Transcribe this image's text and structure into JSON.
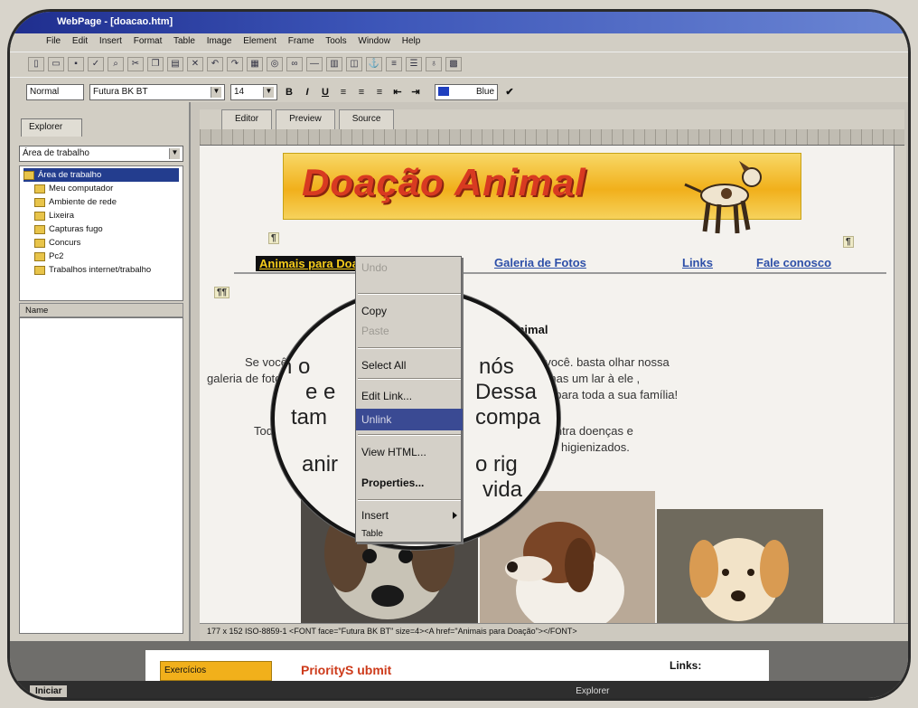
{
  "window": {
    "title": "WebPage - [doacao.htm]"
  },
  "menu": [
    "File",
    "Edit",
    "Insert",
    "Format",
    "Table",
    "Image",
    "Element",
    "Frame",
    "Tools",
    "Window",
    "Help"
  ],
  "format_toolbar": {
    "style": "Normal",
    "font": "Futura BK BT",
    "size": "14",
    "color_label": "Blue"
  },
  "left_panel": {
    "tab_label": "Explorer",
    "location": "Área de trabalho",
    "tree": [
      "Área de trabalho",
      "Meu computador",
      "Ambiente de rede",
      "Lixeira",
      "Capturas fugo",
      "Concurs",
      "Pc2",
      "Trabalhos internet/trabalho"
    ],
    "name_header": "Name"
  },
  "view_tabs": [
    "Editor",
    "Preview",
    "Source"
  ],
  "doc": {
    "banner_title": "Doação Animal",
    "nav": [
      "Animais para Doação",
      "Galeria de Fotos",
      "Links",
      "Fale conosco"
    ],
    "heading": "Doação Animal",
    "para1_line1": "Se você procura um amigo, nós temos o animal ideal pra você. basta olhar nossa",
    "para1_line2": "galeria de fotos. Adotando um animal, você estará dando não apenas um lar à ele ,",
    "para1_line3": "e estará criando um laço especial para toda a sua família!",
    "para2_line1": "Todos os animais são previamente vacinados, tratados contra doenças e",
    "para2_line2": "higienizados."
  },
  "magnified_words": [
    "n o",
    "nós",
    "e e",
    "Dessa",
    "tam",
    "compa",
    "anir",
    "o rig",
    "vida"
  ],
  "context_menu": {
    "items": [
      {
        "label": "Undo",
        "state": "disabled"
      },
      {
        "label": "Copy",
        "state": "normal"
      },
      {
        "label": "Paste",
        "state": "disabled"
      },
      {
        "label": "Select All",
        "state": "normal"
      },
      {
        "label": "Edit Link...",
        "state": "normal"
      },
      {
        "label": "Unlink",
        "state": "highlighted"
      },
      {
        "label": "View HTML...",
        "state": "normal"
      },
      {
        "label": "Properties...",
        "state": "normal"
      },
      {
        "label": "Insert",
        "state": "submenu"
      },
      {
        "label": "Table",
        "state": "normal"
      }
    ]
  },
  "status": {
    "text": "177 x 152   ISO-8859-1   <FONT face=\"Futura BK BT\" size=4><A href=\"Animais para Doação\"></FONT>"
  },
  "lower_panel": {
    "box_text": "Exercícios",
    "title": "PriorityS ubmit",
    "links_label": "Links:"
  },
  "taskbar": {
    "start_label": "Iniciar",
    "tray_text": "Explorer"
  }
}
